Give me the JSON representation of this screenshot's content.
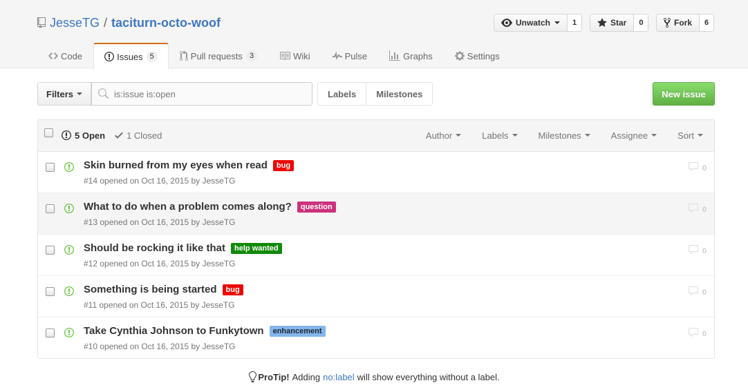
{
  "repo": {
    "owner": "JesseTG",
    "separator": "/",
    "name": "taciturn-octo-woof"
  },
  "actions": {
    "watch": {
      "label": "Unwatch",
      "count": "1"
    },
    "star": {
      "label": "Star",
      "count": "0"
    },
    "fork": {
      "label": "Fork",
      "count": "6"
    }
  },
  "nav": {
    "code": "Code",
    "issues": {
      "label": "Issues",
      "count": "5"
    },
    "pulls": {
      "label": "Pull requests",
      "count": "3"
    },
    "wiki": "Wiki",
    "pulse": "Pulse",
    "graphs": "Graphs",
    "settings": "Settings"
  },
  "subnav": {
    "filters": "Filters",
    "search_value": "is:issue is:open",
    "labels": "Labels",
    "milestones": "Milestones",
    "new_issue": "New issue"
  },
  "table": {
    "open": "5 Open",
    "closed": "1 Closed",
    "filters": [
      "Author",
      "Labels",
      "Milestones",
      "Assignee",
      "Sort"
    ]
  },
  "issues": [
    {
      "title": "Skin burned from my eyes when read",
      "label": "bug",
      "label_bg": "#ee0701",
      "label_fg": "#ffffff",
      "meta": "#14 opened on Oct 16, 2015 by JesseTG",
      "comments": "0"
    },
    {
      "title": "What to do when a problem comes along?",
      "label": "question",
      "label_bg": "#cc317c",
      "label_fg": "#ffffff",
      "meta": "#13 opened on Oct 16, 2015 by JesseTG",
      "comments": "0"
    },
    {
      "title": "Should be rocking it like that",
      "label": "help wanted",
      "label_bg": "#128a0c",
      "label_fg": "#ffffff",
      "meta": "#12 opened on Oct 16, 2015 by JesseTG",
      "comments": "0"
    },
    {
      "title": "Something is being started",
      "label": "bug",
      "label_bg": "#ee0701",
      "label_fg": "#ffffff",
      "meta": "#11 opened on Oct 16, 2015 by JesseTG",
      "comments": "0"
    },
    {
      "title": "Take Cynthia Johnson to Funkytown",
      "label": "enhancement",
      "label_bg": "#84b6eb",
      "label_fg": "#1c2733",
      "meta": "#10 opened on Oct 16, 2015 by JesseTG",
      "comments": "0"
    }
  ],
  "protip": {
    "title": "ProTip!",
    "before": "Adding",
    "link": "no:label",
    "after": "will show everything without a label."
  },
  "colors": {
    "link": "#4078c0",
    "accent_tab": "#d26911",
    "open_green": "#6cc644",
    "new_issue_green": "#60b044"
  },
  "icons": [
    "repo-icon",
    "eye-icon",
    "star-icon",
    "repo-forked-icon",
    "code-icon",
    "issue-opened-icon",
    "git-pull-request-icon",
    "book-icon",
    "pulse-icon",
    "graph-icon",
    "gear-icon",
    "search-icon",
    "check-icon",
    "comment-icon",
    "light-bulb-icon"
  ]
}
